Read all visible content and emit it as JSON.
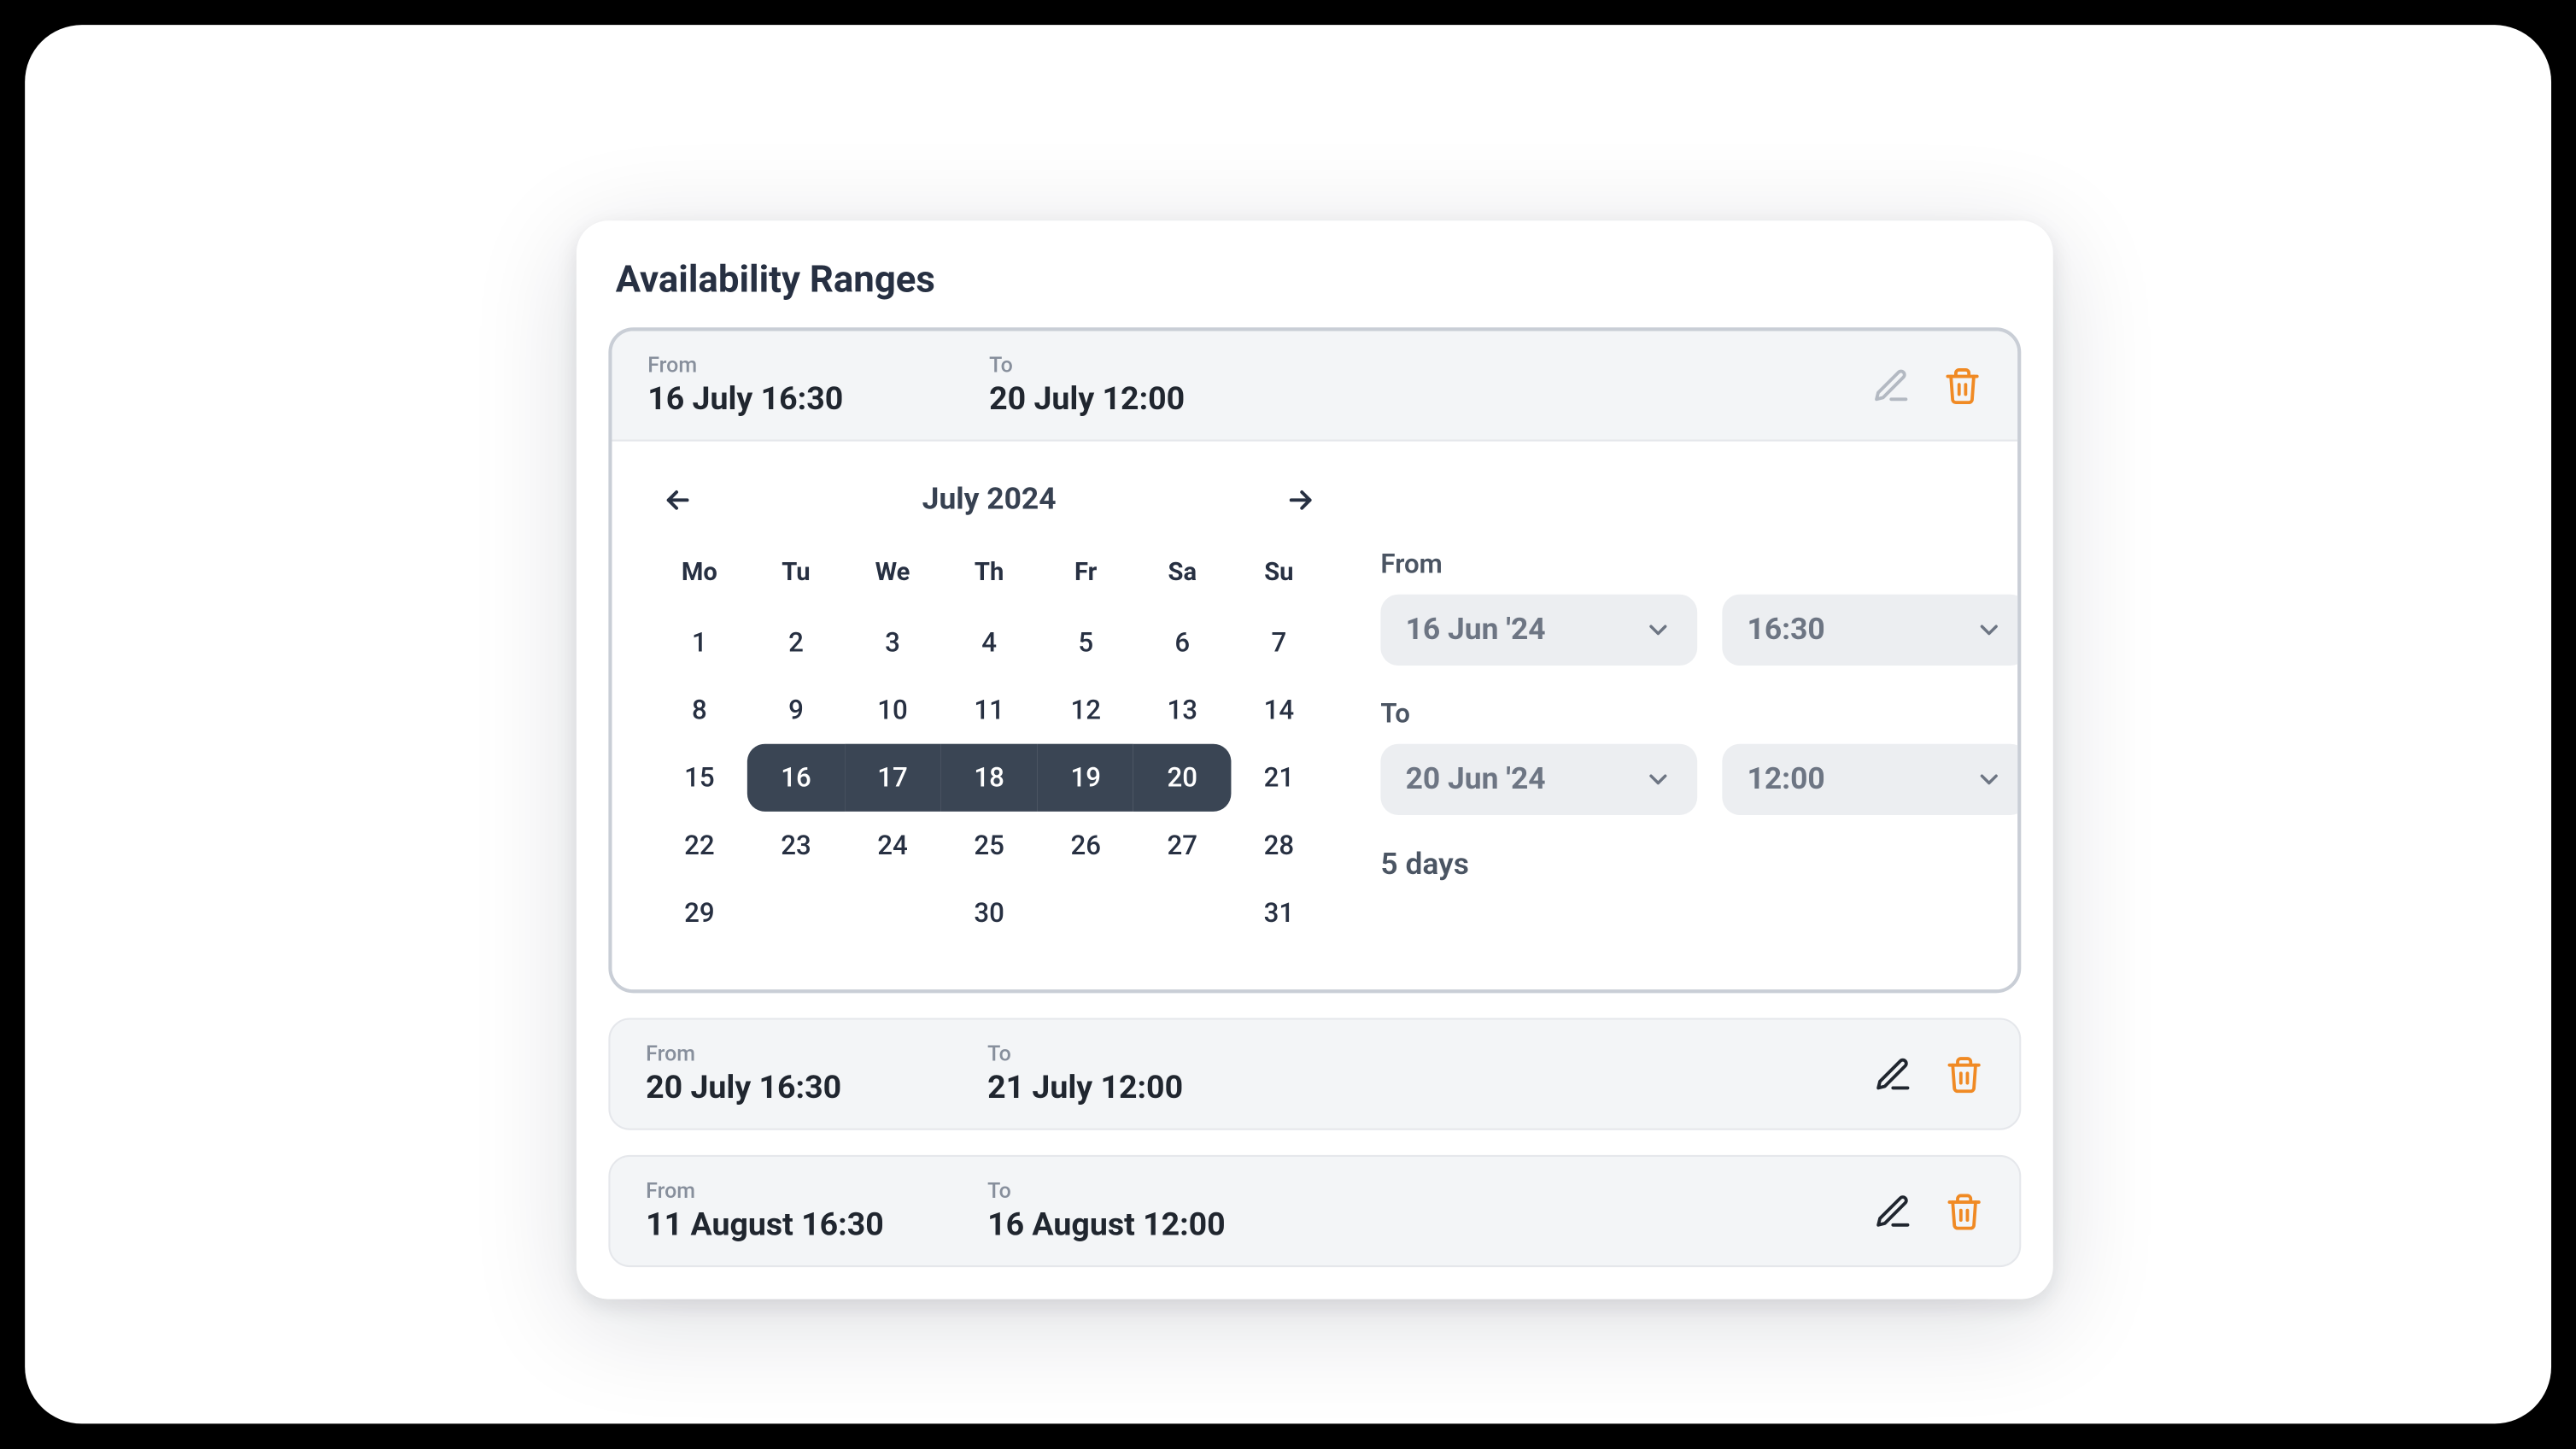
{
  "title": "Availability Ranges",
  "ranges": [
    {
      "from_label": "From",
      "from_value": "16 July 16:30",
      "to_label": "To",
      "to_value": "20 July 12:00",
      "edit_active": false
    },
    {
      "from_label": "From",
      "from_value": "20 July 16:30",
      "to_label": "To",
      "to_value": "21 July 12:00",
      "edit_active": true
    },
    {
      "from_label": "From",
      "from_value": "11 August 16:30",
      "to_label": "To",
      "to_value": "16 August 12:00",
      "edit_active": true
    }
  ],
  "calendar": {
    "month_label": "July 2024",
    "dow": [
      "Mo",
      "Tu",
      "We",
      "Th",
      "Fr",
      "Sa",
      "Su"
    ],
    "weeks": [
      [
        "1",
        "2",
        "3",
        "4",
        "5",
        "6",
        "7"
      ],
      [
        "8",
        "9",
        "10",
        "11",
        "12",
        "13",
        "14"
      ],
      [
        "15",
        "16",
        "17",
        "18",
        "19",
        "20",
        "21"
      ],
      [
        "22",
        "23",
        "24",
        "25",
        "26",
        "27",
        "28"
      ],
      [
        "29",
        "",
        "",
        "30",
        "",
        "",
        "31"
      ]
    ],
    "selected_start": 16,
    "selected_end": 20
  },
  "pickers": {
    "from_label": "From",
    "from_date": "16 Jun '24",
    "from_time": "16:30",
    "to_label": "To",
    "to_date": "20 Jun '24",
    "to_time": "12:00",
    "duration": "5 days"
  }
}
